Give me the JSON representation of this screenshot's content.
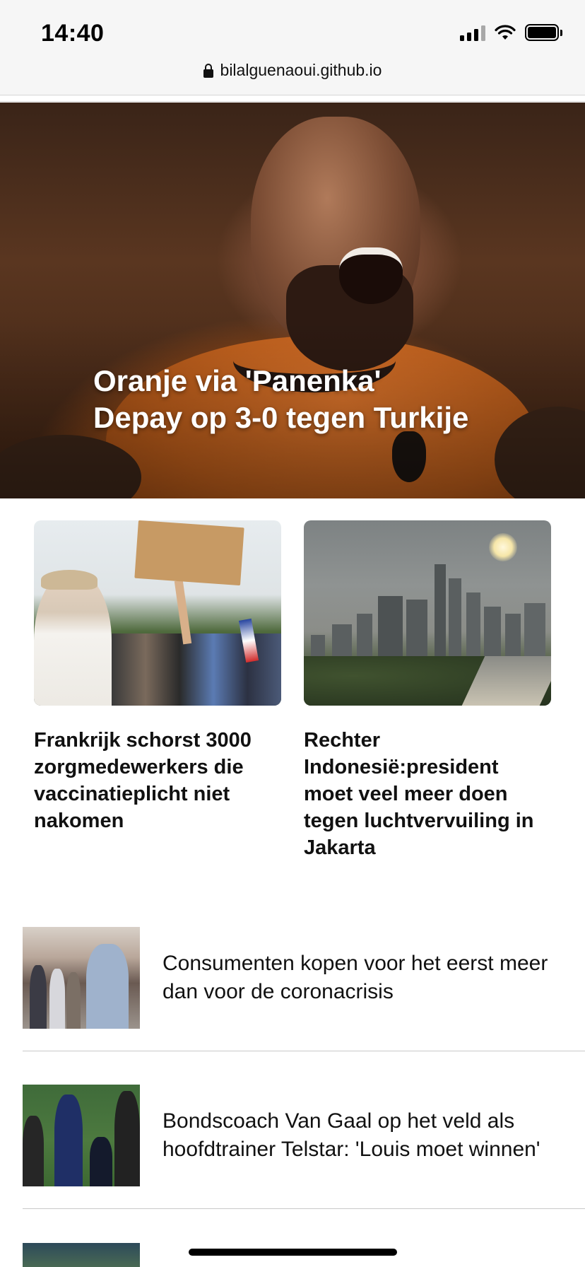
{
  "status_bar": {
    "time": "14:40",
    "icons": [
      "cellular-signal-icon",
      "wifi-icon",
      "battery-icon"
    ]
  },
  "url_bar": {
    "url": "bilalguenaoui.github.io",
    "icon": "lock-icon"
  },
  "hero": {
    "title_line1": "Oranje via 'Panenka'",
    "title_line2": "Depay op 3-0 tegen Turkije"
  },
  "featured": [
    {
      "title": "Frankrijk schorst 3000 zorgmedewerkers die vaccinatieplicht niet nakomen"
    },
    {
      "title": "Rechter Indonesië:president moet veel meer doen tegen luchtvervuiling in Jakarta"
    }
  ],
  "list": [
    {
      "title": "Consumenten kopen voor het eerst meer dan voor de coronacrisis"
    },
    {
      "title": "Bondscoach Van Gaal op het veld als hoofdtrainer Telstar: 'Louis moet winnen'"
    }
  ]
}
